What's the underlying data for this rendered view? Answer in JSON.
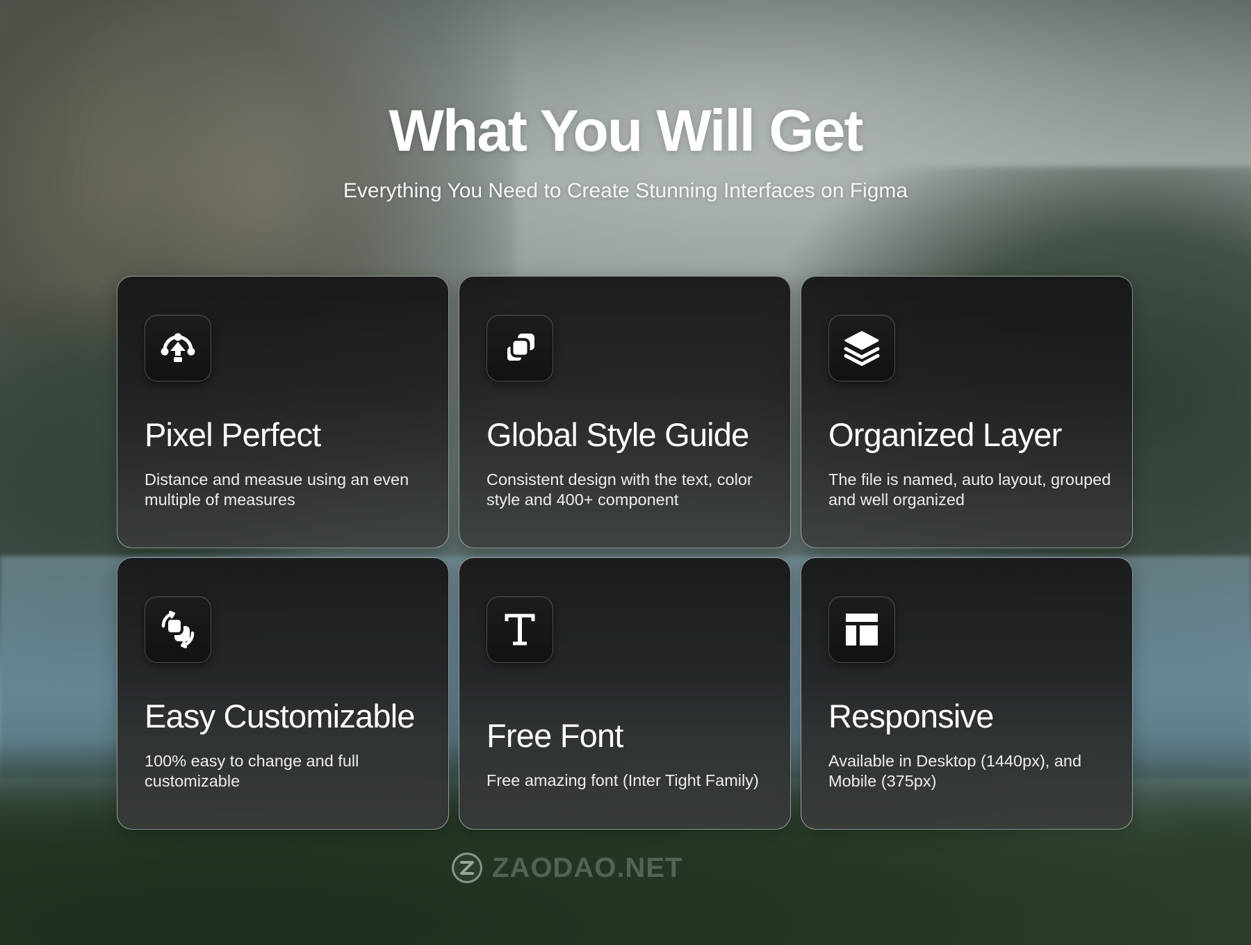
{
  "header": {
    "title": "What You Will Get",
    "subtitle": "Everything You Need to Create Stunning Interfaces on Figma"
  },
  "features": [
    {
      "icon": "pixel-anchor-icon",
      "title": "Pixel Perfect",
      "description": "Distance and measue using an even multiple of measures"
    },
    {
      "icon": "components-icon",
      "title": "Global Style Guide",
      "description": "Consistent design with the text, color style and 400+ component"
    },
    {
      "icon": "layers-icon",
      "title": "Organized Layer",
      "description": "The file is named, auto layout, grouped and well organized"
    },
    {
      "icon": "customize-shapes-icon",
      "title": "Easy Customizable",
      "description": "100% easy to change and full customizable"
    },
    {
      "icon": "text-font-icon",
      "title": "Free Font",
      "description": "Free amazing font (Inter Tight Family)"
    },
    {
      "icon": "layout-icon",
      "title": "Responsive",
      "description": "Available in Desktop (1440px), and Mobile (375px)"
    }
  ],
  "watermark": {
    "logo_icon": "z-logo-icon",
    "text": "ZAODAO.NET"
  },
  "colors": {
    "card_background": "#1e1e1f",
    "card_border": "#e6ebe9",
    "text_primary": "#ffffff",
    "text_secondary": "#ededed"
  }
}
